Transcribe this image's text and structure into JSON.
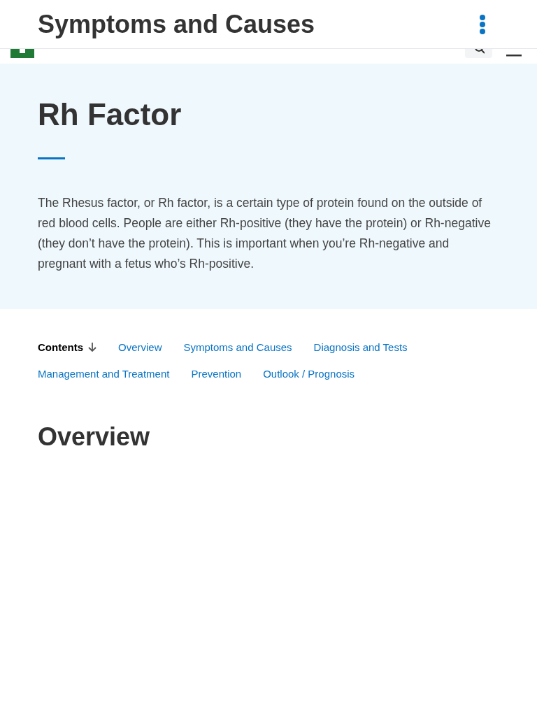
{
  "top_bar": {
    "title": "Symptoms and Causes"
  },
  "hero": {
    "title": "Rh Factor",
    "summary": "The Rhesus factor, or Rh factor, is a certain type of protein found on the outside of red blood cells. People are either Rh-positive (they have the protein) or Rh-negative (they don’t have the protein). This is important when you’re Rh-negative and pregnant with a fetus who’s Rh-positive."
  },
  "contents": {
    "label": "Contents",
    "links": [
      "Overview",
      "Symptoms and Causes",
      "Diagnosis and Tests",
      "Management and Treatment",
      "Prevention",
      "Outlook / Prognosis"
    ]
  },
  "section_heading": "Overview"
}
